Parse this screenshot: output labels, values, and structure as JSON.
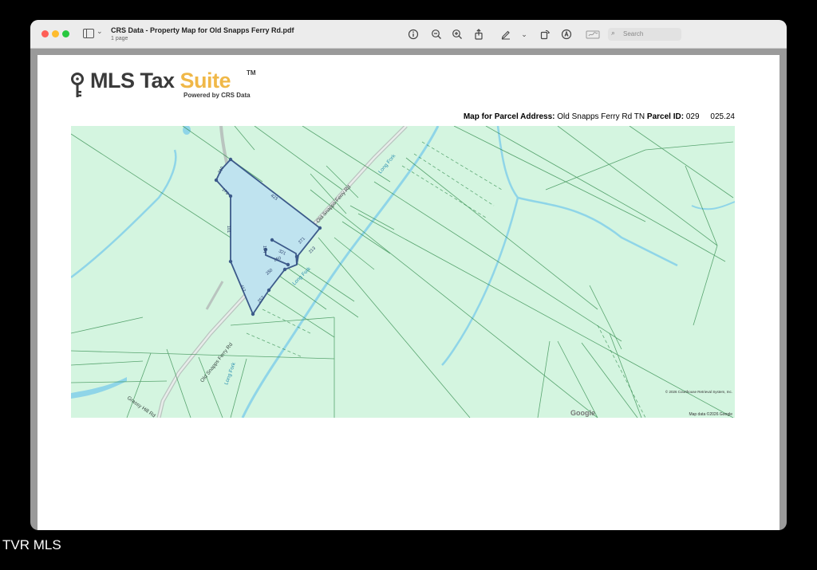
{
  "window": {
    "title": "CRS Data - Property Map for Old Snapps Ferry Rd.pdf",
    "subtitle": "1 page",
    "search_placeholder": "Search"
  },
  "toolbar": {
    "icons": [
      "info-icon",
      "zoom-out-icon",
      "zoom-in-icon",
      "share-icon",
      "markup-pen-icon",
      "chevron-down-icon",
      "rotate-icon",
      "annotate-icon",
      "signature-icon"
    ]
  },
  "logo": {
    "brand_main": "MLS Tax ",
    "brand_accent": "Suite",
    "trademark": "TM",
    "powered_by": "Powered by CRS Data",
    "accent_color": "#f0b848"
  },
  "parcel": {
    "address_label": "Map for Parcel Address:",
    "address": "Old Snapps Ferry Rd TN",
    "id_label": "Parcel ID:",
    "id": "029     025.24"
  },
  "map": {
    "road_labels": [
      "Old Snapps Ferry Rd",
      "Old Snapps Ferry Rd",
      "Grassy Hill Rd"
    ],
    "creek_labels": [
      "Long Fork",
      "Long Fork",
      "Long Fork"
    ],
    "dimension_labels": [
      "210",
      "173",
      "423",
      "101",
      "412",
      "271",
      "321",
      "250",
      "250",
      "104",
      "257",
      "213"
    ],
    "copyright": "© 2026 Courthouse Retrieval System, Inc.",
    "attribution": "Map data ©2026 Google",
    "google_mark": "Google",
    "parcel_fill": "#bfe3ef",
    "water_color": "#8fd5e8",
    "background": "#d4f5e0"
  },
  "footer": {
    "label": "TVR MLS"
  }
}
